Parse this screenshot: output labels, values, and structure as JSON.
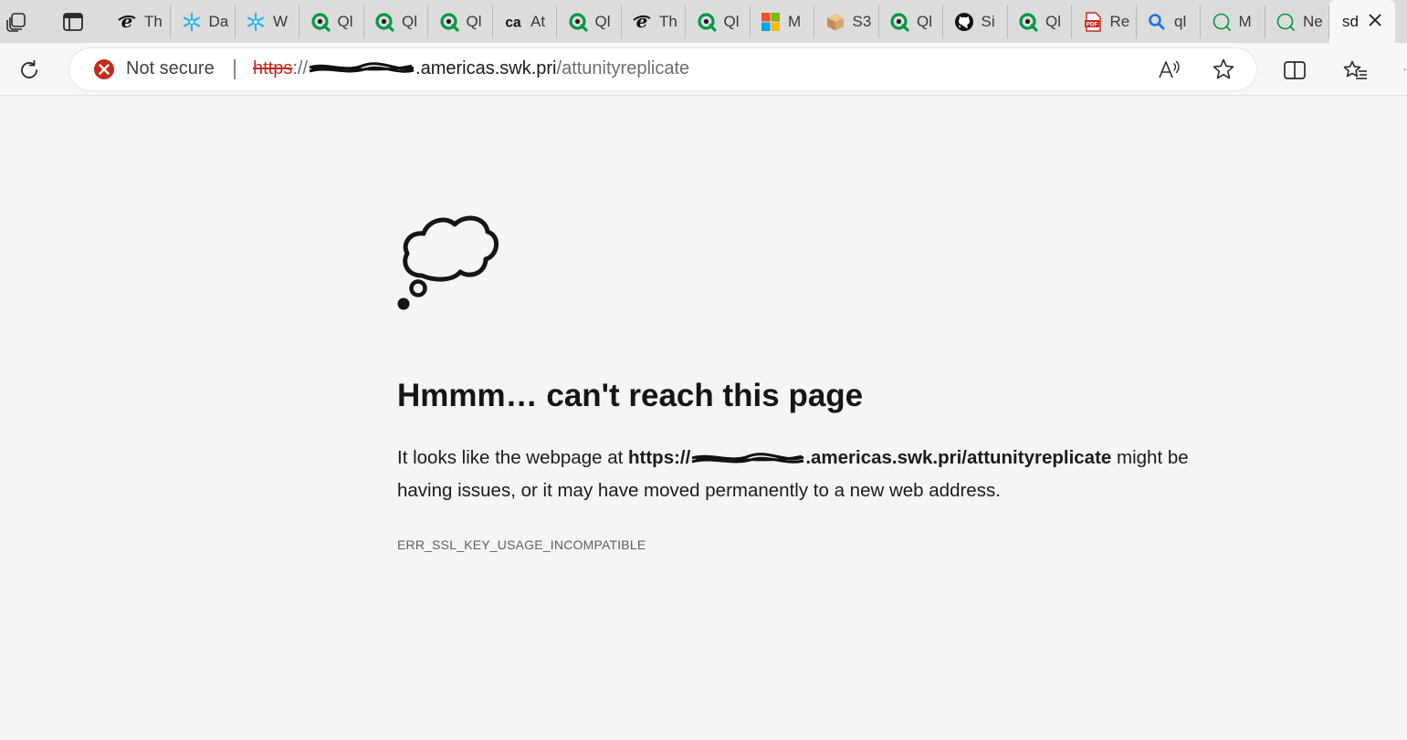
{
  "tabs": [
    {
      "favicon": "ie-icon",
      "label": "Th"
    },
    {
      "favicon": "snowflake-icon",
      "label": "Da"
    },
    {
      "favicon": "snowflake-icon",
      "label": "W"
    },
    {
      "favicon": "qlik-icon",
      "label": "Ql"
    },
    {
      "favicon": "qlik-icon",
      "label": "Ql"
    },
    {
      "favicon": "qlik-icon",
      "label": "Ql"
    },
    {
      "favicon": "ca-icon",
      "label": "At"
    },
    {
      "favicon": "qlik-icon",
      "label": "Ql"
    },
    {
      "favicon": "ie-icon",
      "label": "Th"
    },
    {
      "favicon": "qlik-icon",
      "label": "Ql"
    },
    {
      "favicon": "microsoft-icon",
      "label": "M"
    },
    {
      "favicon": "box-icon",
      "label": "S3"
    },
    {
      "favicon": "qlik-icon",
      "label": "Ql"
    },
    {
      "favicon": "github-icon",
      "label": "Si"
    },
    {
      "favicon": "qlik-icon",
      "label": "Ql"
    },
    {
      "favicon": "pdf-icon",
      "label": "Re"
    },
    {
      "favicon": "search-icon",
      "label": "ql"
    },
    {
      "favicon": "qlik-outline-icon",
      "label": "M"
    },
    {
      "favicon": "qlik-outline-icon",
      "label": "Ne"
    }
  ],
  "active_tab": {
    "label": "sd"
  },
  "address_bar": {
    "security_label": "Not secure",
    "url_scheme": "https",
    "url_separator": "://",
    "url_host_visible": ".americas.swk.pri",
    "url_path": "/attunityreplicate"
  },
  "error": {
    "title": "Hmmm… can't reach this page",
    "body_prefix": "It looks like the webpage at ",
    "body_url_prefix": "https://",
    "body_url_suffix": ".americas.swk.pri/attunityreplicate",
    "body_suffix": " might be having issues, or it may have moved permanently to a new web address.",
    "code": "ERR_SSL_KEY_USAGE_INCOMPATIBLE"
  },
  "colors": {
    "not_secure_red": "#c42b1c",
    "qlik_green": "#009845",
    "page_background": "#f5f5f5"
  }
}
